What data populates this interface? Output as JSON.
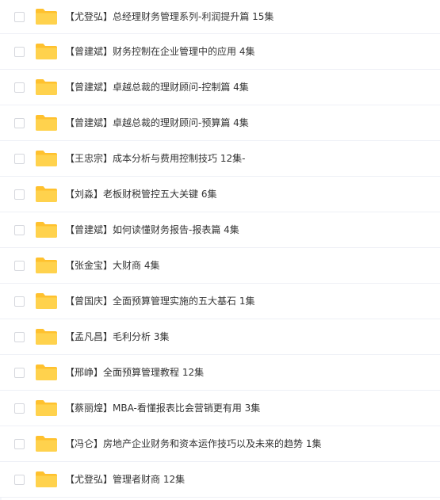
{
  "file_list": {
    "folder_icon": "folder-icon",
    "folder_color": "#ffd24d",
    "folder_tab_color": "#ffc12e",
    "rows": [
      {
        "name": "【尤登弘】总经理财务管理系列-利润提升篇 15集"
      },
      {
        "name": "【曾建斌】财务控制在企业管理中的应用 4集"
      },
      {
        "name": "【曾建斌】卓越总裁的理财顾问-控制篇 4集"
      },
      {
        "name": "【曾建斌】卓越总裁的理财顾问-预算篇 4集"
      },
      {
        "name": "【王忠宗】成本分析与费用控制技巧 12集-"
      },
      {
        "name": "【刘淼】老板财税管控五大关键 6集"
      },
      {
        "name": "【曾建斌】如何读懂财务报告-报表篇 4集"
      },
      {
        "name": "【张金宝】大财商 4集"
      },
      {
        "name": "【曾国庆】全面预算管理实施的五大基石 1集"
      },
      {
        "name": "【孟凡昌】毛利分析 3集"
      },
      {
        "name": "【邢峥】全面预算管理教程 12集"
      },
      {
        "name": "【蔡丽煌】MBA-看懂报表比会营销更有用 3集"
      },
      {
        "name": "【冯仑】房地产企业财务和资本运作技巧以及未来的趋势 1集"
      },
      {
        "name": "【尤登弘】管理者财商 12集"
      }
    ]
  }
}
